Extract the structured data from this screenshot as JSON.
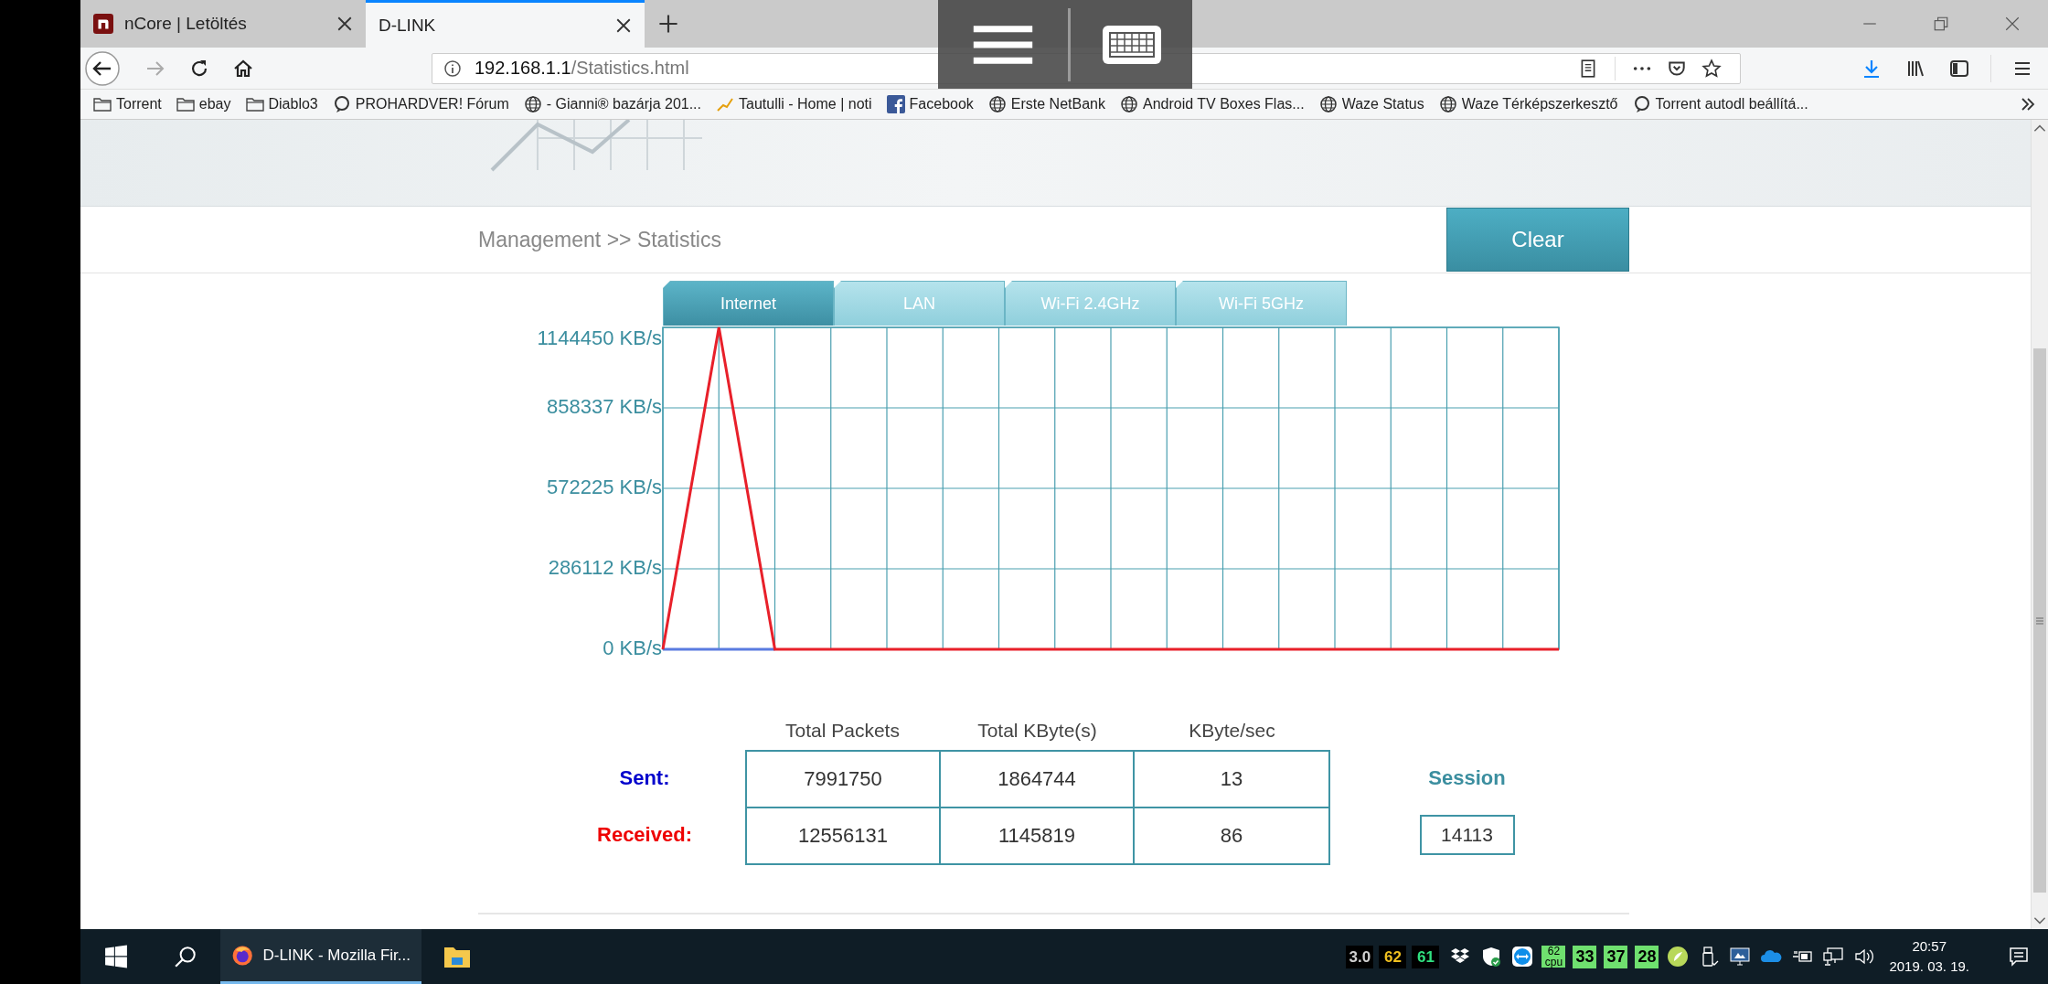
{
  "browser": {
    "tabs": [
      {
        "title": "nCore | Letöltés",
        "selected": false,
        "icon": true
      },
      {
        "title": "D-LINK",
        "selected": true,
        "icon": false
      }
    ],
    "address": {
      "host": "192.168.1.1",
      "path": "/Statistics.html"
    },
    "bookmarks": [
      {
        "label": "Torrent",
        "kind": "folder"
      },
      {
        "label": "ebay",
        "kind": "folder"
      },
      {
        "label": "Diablo3",
        "kind": "folder"
      },
      {
        "label": "PROHARDVER! Fórum",
        "kind": "ring"
      },
      {
        "label": "- Gianni® bazárja 201...",
        "kind": "globe"
      },
      {
        "label": "Tautulli - Home | noti",
        "kind": "tautulli"
      },
      {
        "label": "Facebook",
        "kind": "facebook"
      },
      {
        "label": "Erste NetBank",
        "kind": "globe"
      },
      {
        "label": "Android TV Boxes Flas...",
        "kind": "globe"
      },
      {
        "label": "Waze Status",
        "kind": "globe"
      },
      {
        "label": "Waze Térképszerkesztő",
        "kind": "globe"
      },
      {
        "label": "Torrent autodl beállítá...",
        "kind": "ring"
      }
    ]
  },
  "page": {
    "breadcrumb": "Management >> Statistics",
    "clear_button": "Clear",
    "tabs": [
      {
        "label": "Internet",
        "selected": true
      },
      {
        "label": "LAN",
        "selected": false
      },
      {
        "label": "Wi-Fi 2.4GHz",
        "selected": false
      },
      {
        "label": "Wi-Fi 5GHz",
        "selected": false
      }
    ],
    "chart_data": {
      "type": "line",
      "grid": true,
      "categories": [
        null,
        null,
        null,
        null,
        null,
        null,
        null,
        null,
        null,
        null,
        null,
        null,
        null,
        null,
        null,
        null,
        null
      ],
      "ylim": [
        0,
        1144450
      ],
      "yticks": [
        {
          "value": 0,
          "label": "0 KB/s"
        },
        {
          "value": 286112,
          "label": "286112 KB/s"
        },
        {
          "value": 572225,
          "label": "572225 KB/s"
        },
        {
          "value": 858337,
          "label": "858337 KB/s"
        },
        {
          "value": 1144450,
          "label": "1144450 KB/s"
        }
      ],
      "series": [
        {
          "color": "#5a7be0",
          "values": [
            0,
            0,
            0,
            null,
            null,
            null,
            null,
            null,
            null,
            null,
            null,
            null,
            null,
            null,
            null,
            null,
            null
          ]
        },
        {
          "color": "#e8202a",
          "values": [
            0,
            1144450,
            0,
            0,
            0,
            0,
            0,
            0,
            0,
            0,
            0,
            0,
            0,
            0,
            0,
            0,
            0
          ]
        }
      ]
    },
    "stats": {
      "columns": [
        "Total Packets",
        "Total KByte(s)",
        "KByte/sec"
      ],
      "rows": [
        {
          "label": "Sent:",
          "color": "#0000cc",
          "values": [
            "7991750",
            "1864744",
            "13"
          ]
        },
        {
          "label": "Received:",
          "color": "#ee0000",
          "values": [
            "12556131",
            "1145819",
            "86"
          ]
        }
      ],
      "session": {
        "label": "Session",
        "value": "14113"
      }
    }
  },
  "taskbar": {
    "task": {
      "label": "D-LINK - Mozilla Fir...",
      "selected": true
    },
    "readings": [
      {
        "text": "3.0",
        "color": "#d0d0d0"
      },
      {
        "text": "62",
        "color": "#f0c020"
      },
      {
        "text": "61",
        "color": "#30e080"
      }
    ],
    "cpu": {
      "value": "62",
      "unit": "cpu"
    },
    "temperatures": [
      "33",
      "37",
      "28"
    ],
    "clock": {
      "time": "20:57",
      "date": "2019. 03. 19."
    }
  }
}
